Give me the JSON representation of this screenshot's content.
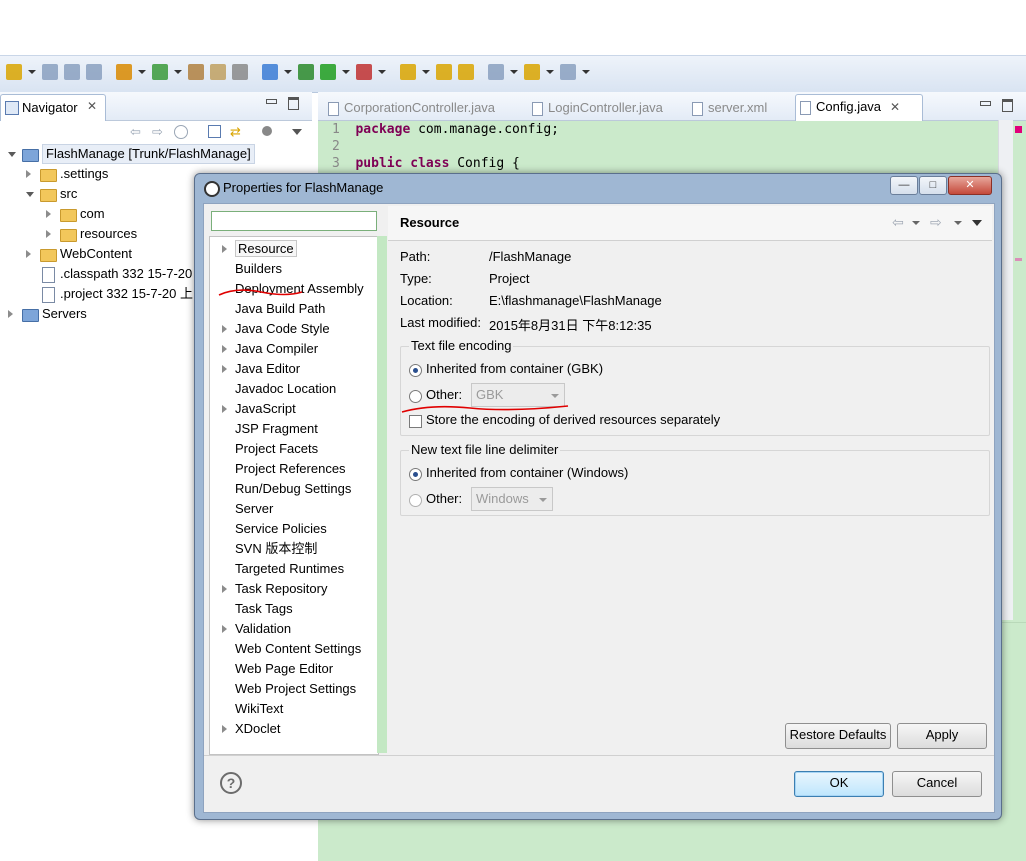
{
  "toolbar": {
    "icons": [
      "new-icon",
      "save-icon",
      "save-all-icon",
      "print-icon",
      "build-icon",
      "refresh-icon",
      "pin-icon",
      "edit-icon",
      "copy-icon",
      "run-icon",
      "debug-icon",
      "play-icon",
      "external-tools-icon",
      "open-type-icon",
      "open-resource-icon",
      "search-icon",
      "next-annotation-icon",
      "back-icon",
      "forward-icon"
    ]
  },
  "navigator": {
    "tab_label": "Navigator",
    "tree": [
      {
        "label": "FlashManage [Trunk/FlashManage]",
        "level": 0,
        "type": "project"
      },
      {
        "label": ".settings",
        "level": 1,
        "type": "folder"
      },
      {
        "label": "src",
        "level": 1,
        "type": "folder"
      },
      {
        "label": "com",
        "level": 2,
        "type": "folder"
      },
      {
        "label": "resources",
        "level": 2,
        "type": "folder"
      },
      {
        "label": "WebContent",
        "level": 1,
        "type": "folder"
      },
      {
        "label": ".classpath 332  15-7-20",
        "level": 1,
        "type": "file"
      },
      {
        "label": ".project 332  15-7-20 上",
        "level": 1,
        "type": "file"
      },
      {
        "label": "Servers",
        "level": 0,
        "type": "project"
      }
    ]
  },
  "editor": {
    "tabs": [
      {
        "label": "CorporationController.java",
        "active": false
      },
      {
        "label": "LoginController.java",
        "active": false
      },
      {
        "label": "server.xml",
        "active": false
      },
      {
        "label": "Config.java",
        "active": true
      }
    ],
    "lines": [
      {
        "num": "1",
        "kw": "package",
        "text": " com.manage.config;"
      },
      {
        "num": "2",
        "kw": "",
        "text": ""
      },
      {
        "num": "3",
        "kw": "public class",
        "text": " Config {"
      }
    ]
  },
  "dialog": {
    "title": "Properties for FlashManage",
    "filter_value": "",
    "pages": [
      {
        "label": "Resource",
        "expandable": true,
        "selected": true
      },
      {
        "label": "Builders",
        "expandable": false
      },
      {
        "label": "Deployment Assembly",
        "expandable": false
      },
      {
        "label": "Java Build Path",
        "expandable": false
      },
      {
        "label": "Java Code Style",
        "expandable": true
      },
      {
        "label": "Java Compiler",
        "expandable": true
      },
      {
        "label": "Java Editor",
        "expandable": true
      },
      {
        "label": "Javadoc Location",
        "expandable": false
      },
      {
        "label": "JavaScript",
        "expandable": true
      },
      {
        "label": "JSP Fragment",
        "expandable": false
      },
      {
        "label": "Project Facets",
        "expandable": false
      },
      {
        "label": "Project References",
        "expandable": false
      },
      {
        "label": "Run/Debug Settings",
        "expandable": false
      },
      {
        "label": "Server",
        "expandable": false
      },
      {
        "label": "Service Policies",
        "expandable": false
      },
      {
        "label": "SVN 版本控制",
        "expandable": false
      },
      {
        "label": "Targeted Runtimes",
        "expandable": false
      },
      {
        "label": "Task Repository",
        "expandable": true
      },
      {
        "label": "Task Tags",
        "expandable": false
      },
      {
        "label": "Validation",
        "expandable": true
      },
      {
        "label": "Web Content Settings",
        "expandable": false
      },
      {
        "label": "Web Page Editor",
        "expandable": false
      },
      {
        "label": "Web Project Settings",
        "expandable": false
      },
      {
        "label": "WikiText",
        "expandable": false
      },
      {
        "label": "XDoclet",
        "expandable": true
      }
    ],
    "page_title": "Resource",
    "props": [
      {
        "label": "Path:",
        "value": "/FlashManage"
      },
      {
        "label": "Type:",
        "value": "Project"
      },
      {
        "label": "Location:",
        "value": "E:\\flashmanage\\FlashManage"
      },
      {
        "label": "Last modified:",
        "value": "2015年8月31日 下午8:12:35"
      }
    ],
    "encoding": {
      "group_title": "Text file encoding",
      "inherited_label": "Inherited from container (GBK)",
      "other_label": "Other:",
      "other_value": "GBK",
      "derived_label": "Store the encoding of derived resources separately"
    },
    "delimiter": {
      "group_title": "New text file line delimiter",
      "inherited_label": "Inherited from container (Windows)",
      "other_label": "Other:",
      "other_value": "Windows"
    },
    "buttons": {
      "restore": "Restore Defaults",
      "apply": "Apply",
      "ok": "OK",
      "cancel": "Cancel"
    },
    "help": "?",
    "win_buttons": {
      "minimize": "—",
      "maximize": "□",
      "close": "✕"
    }
  }
}
